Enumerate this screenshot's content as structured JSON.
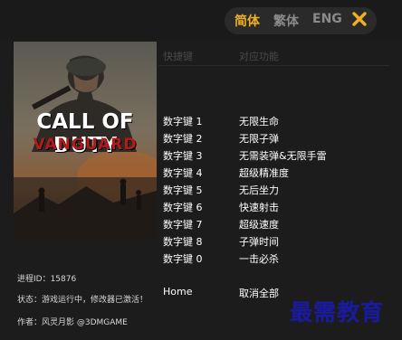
{
  "languages": [
    {
      "label": "简体",
      "active": true
    },
    {
      "label": "繁体",
      "active": false
    },
    {
      "label": "ENG",
      "active": false
    }
  ],
  "close_icon": "close-x-icon",
  "colors": {
    "accent": "#f0b020",
    "background": "#1c1c1c",
    "text": "#ffffff",
    "header_text": "#4a4a4a"
  },
  "cover": {
    "title": "CALL OF DUTY",
    "subtitle": "VANGUARD"
  },
  "table": {
    "header_key": "快捷键",
    "header_function": "对应功能",
    "rows": [
      {
        "key": "数字键 1",
        "function": "无限生命"
      },
      {
        "key": "数字键 2",
        "function": "无限子弹"
      },
      {
        "key": "数字键 3",
        "function": "无需装弹&无限手雷"
      },
      {
        "key": "数字键 4",
        "function": "超级精准度"
      },
      {
        "key": "数字键 5",
        "function": "无后坐力"
      },
      {
        "key": "数字键 6",
        "function": "快速射击"
      },
      {
        "key": "数字键 7",
        "function": "超级速度"
      },
      {
        "key": "数字键 8",
        "function": "子弹时间"
      },
      {
        "key": "数字键 0",
        "function": "一击必杀"
      },
      {
        "key": "Home",
        "function": "取消全部"
      }
    ]
  },
  "info": {
    "process_id": "进程ID：15876",
    "status": "状态：游戏运行中，修改器已激活！",
    "author": "作者：风灵月影 @3DMGAME"
  },
  "watermark": "最需教育"
}
